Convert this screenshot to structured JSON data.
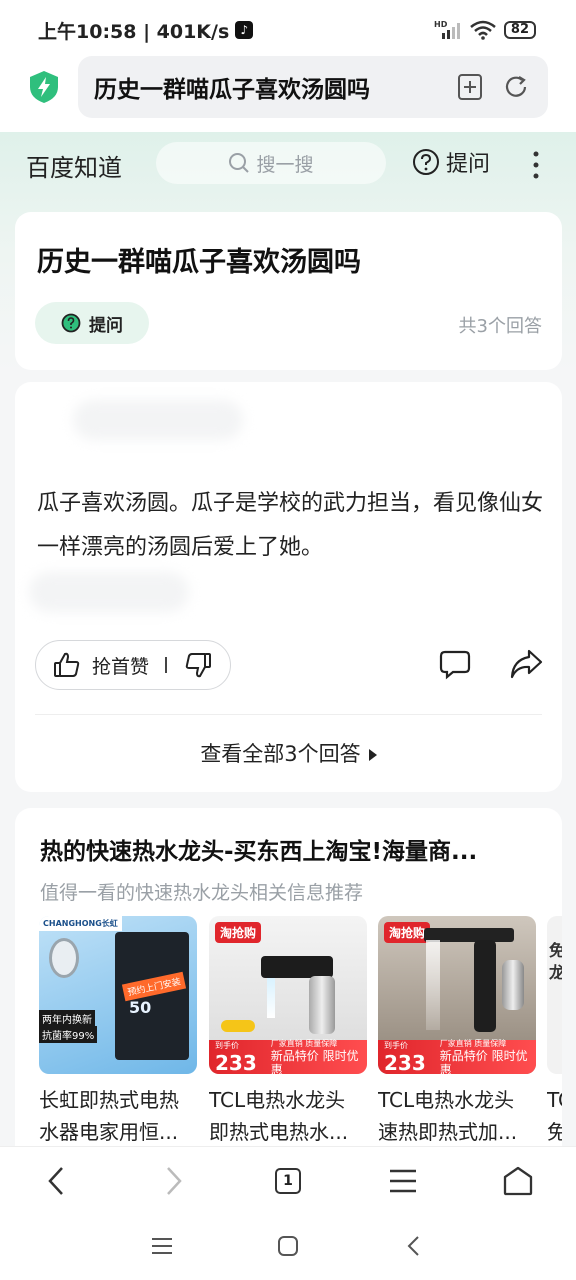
{
  "status_bar": {
    "time_speed": "上午10:58 | 401K/s",
    "hd": "HD",
    "battery": "82"
  },
  "browser": {
    "address_text": "历史一群喵瓜子喜欢汤圆吗"
  },
  "header": {
    "brand": "百度知道",
    "search_placeholder": "搜一搜",
    "ask_label": "提问"
  },
  "question": {
    "title": "历史一群喵瓜子喜欢汤圆吗",
    "ask_button": "提问",
    "answer_count": "共3个回答"
  },
  "answer": {
    "text": "瓜子喜欢汤圆。瓜子是学校的武力担当，看见像仙女一样漂亮的汤圆后爱上了她。",
    "like_label": "抢首赞",
    "view_all": "查看全部3个回答"
  },
  "ad": {
    "title": "热的快速热水龙头-买东西上淘宝!海量商...",
    "subtitle": "值得一看的快速热水龙头相关信息推荐",
    "products": [
      {
        "line1": "长虹即热式电热",
        "line2": "水器电家用恒...",
        "brand_tag": "CHANGHONG长虹",
        "badge1": "两年内换新",
        "badge2": "抗菌率99%",
        "promo": "预约上门安装",
        "display": "50"
      },
      {
        "line1": "TCL电热水龙头",
        "line2": "即热式电热水...",
        "tag": "淘抢购",
        "price_label": "到手价",
        "price": "233",
        "promo_small": "厂家直销 质量保障",
        "promo_big": "新品特价 限时优惠"
      },
      {
        "line1": "TCL电热水龙头",
        "line2": "速热即热式加...",
        "tag": "淘抢购",
        "price_label": "到手价",
        "price": "233",
        "promo_small": "厂家直销 质量保障",
        "promo_big": "新品特价 限时优惠"
      },
      {
        "line1": "TC",
        "line2": "免",
        "img_text": "免龙"
      }
    ]
  },
  "bottom_bar": {
    "tab_count": "1"
  },
  "colors": {
    "accent_green": "#2fbf7d",
    "header_bg": "#dff1ea",
    "price_red": "#e0262c"
  },
  "icons": [
    "shield-bolt-icon",
    "add-bookmark-icon",
    "refresh-icon",
    "search-icon",
    "question-icon",
    "more-icon",
    "thumb-up-icon",
    "thumb-down-icon",
    "comment-icon",
    "share-icon",
    "back-icon",
    "forward-icon",
    "tabs-icon",
    "menu-icon",
    "home-icon"
  ]
}
